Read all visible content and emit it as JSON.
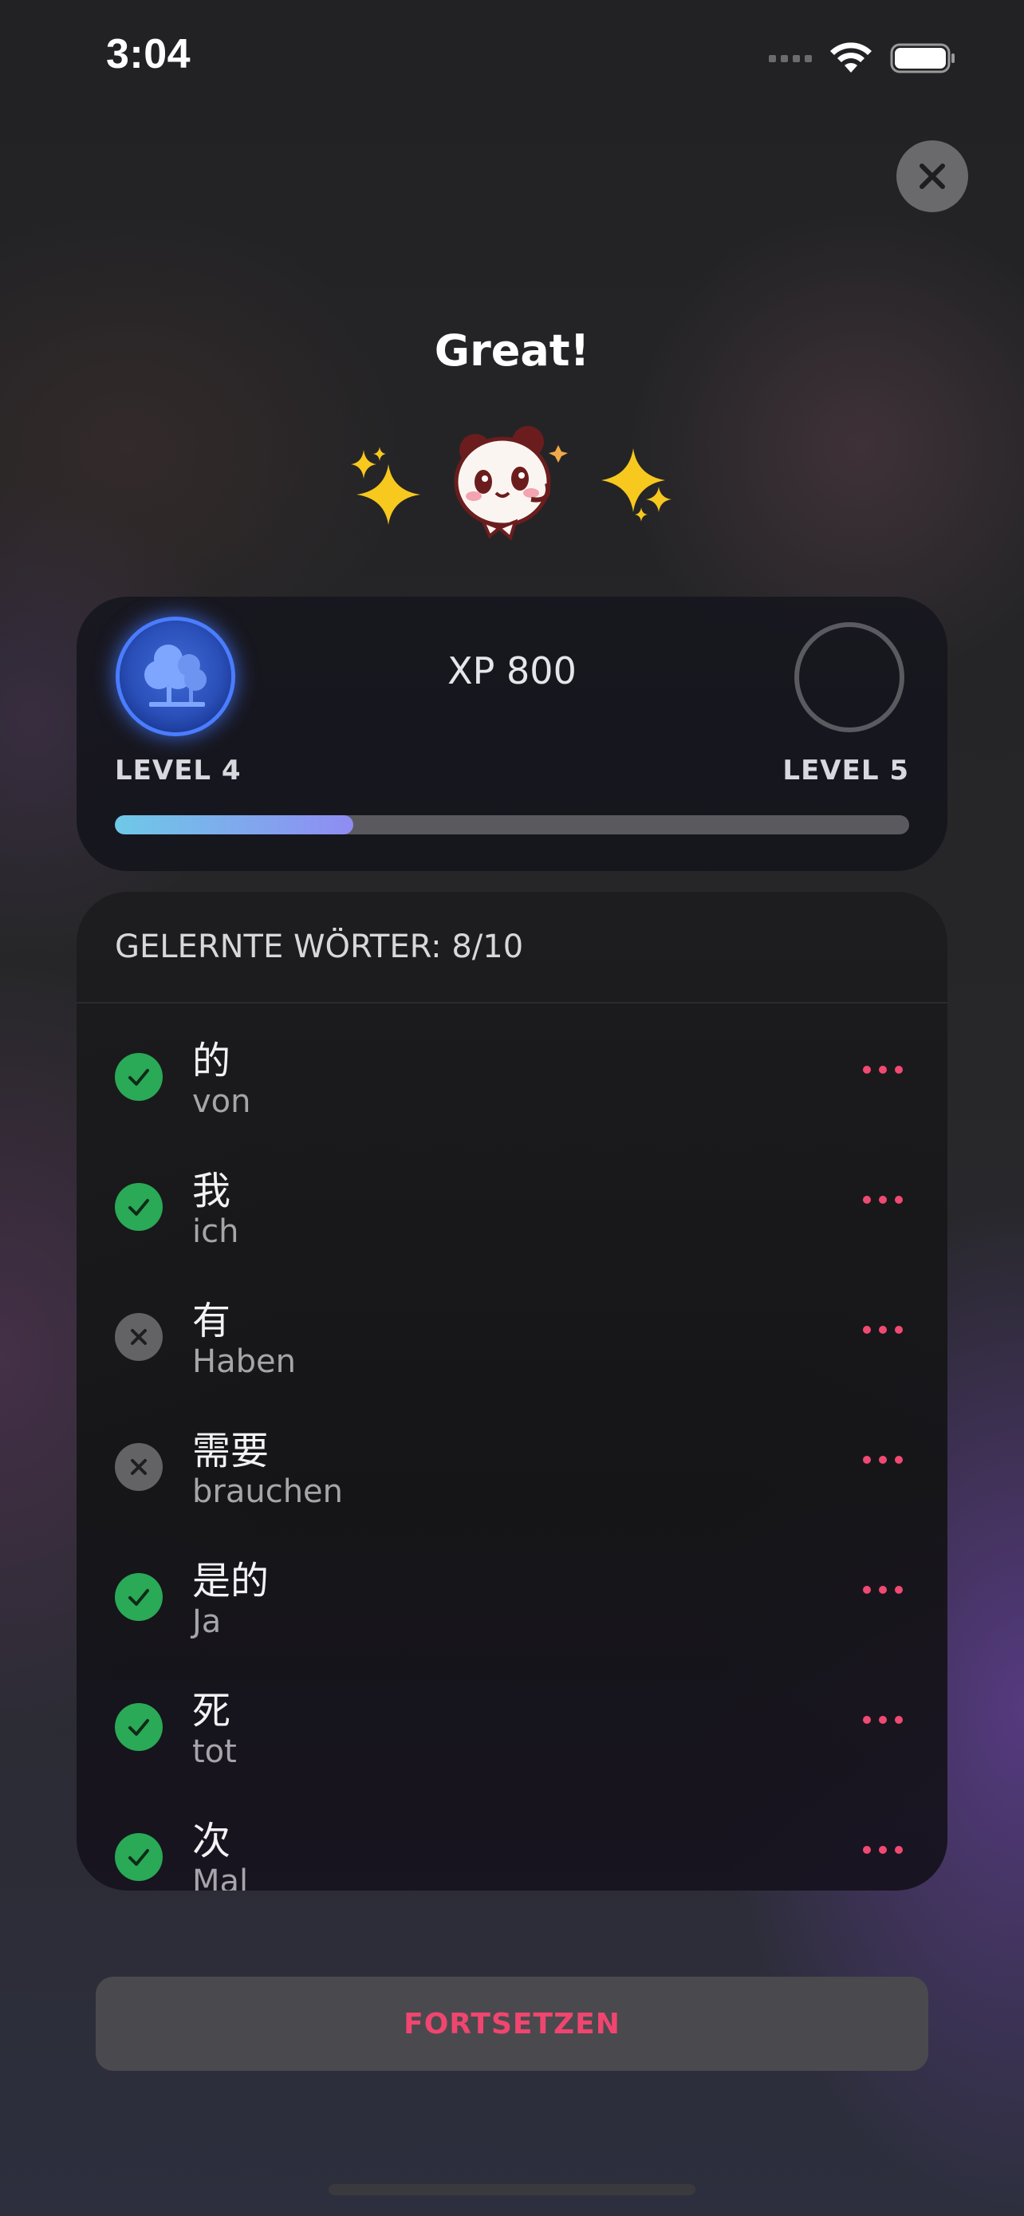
{
  "status_bar": {
    "time": "3:04"
  },
  "header": {
    "title": "Great!"
  },
  "xp": {
    "value_label": "XP 800",
    "current_level": "LEVEL 4",
    "next_level": "LEVEL 5",
    "progress_percent": 30
  },
  "words": {
    "header": "GELERNTE WÖRTER: 8/10",
    "items": [
      {
        "hanzi": "的",
        "translation": "von",
        "learned": true
      },
      {
        "hanzi": "我",
        "translation": "ich",
        "learned": true
      },
      {
        "hanzi": "有",
        "translation": "Haben",
        "learned": false
      },
      {
        "hanzi": "需要",
        "translation": "brauchen",
        "learned": false
      },
      {
        "hanzi": "是的",
        "translation": "Ja",
        "learned": true
      },
      {
        "hanzi": "死",
        "translation": "tot",
        "learned": true
      },
      {
        "hanzi": "次",
        "translation": "Mal",
        "learned": true
      }
    ]
  },
  "footer": {
    "continue_label": "FORTSETZEN"
  },
  "colors": {
    "accent": "#f0456f",
    "success": "#2aa956",
    "neutral": "#636366",
    "level_badge": "#3f6bd8"
  },
  "icons": {
    "close": "close-icon",
    "learned": "check-icon",
    "not_learned": "x-icon",
    "more": "more-dots-icon",
    "level_badge": "trees-icon"
  }
}
